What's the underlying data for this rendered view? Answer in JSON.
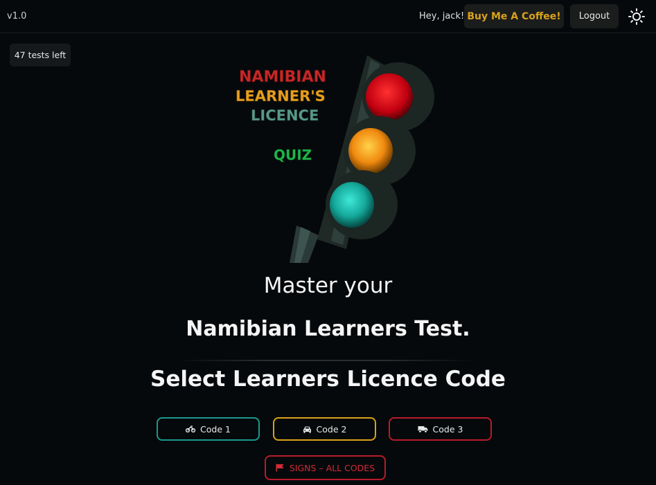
{
  "header": {
    "version": "v1.0",
    "greeting": "Hey, jack!",
    "coffee_label": "Buy Me A Coffee!",
    "logout_label": "Logout",
    "theme_icon": "sun-icon"
  },
  "badge": {
    "tests_left": "47 tests left"
  },
  "logo": {
    "line1": "NAMIBIAN",
    "line2": "LEARNER'S",
    "line3": "LICENCE",
    "line4": "QUIZ"
  },
  "hero": {
    "tagline_1": "Master your",
    "tagline_2": "Namibian Learners Test.",
    "select_title": "Select Learners Licence Code"
  },
  "codes": [
    {
      "label": "Code 1",
      "icon": "motorcycle-icon",
      "color": "#1a9a8c"
    },
    {
      "label": "Code 2",
      "icon": "car-icon",
      "color": "#d9a21b"
    },
    {
      "label": "Code 3",
      "icon": "truck-icon",
      "color": "#b71c2a"
    }
  ],
  "signs": {
    "label": "SIGNS – ALL CODES",
    "icon": "flag-icon",
    "color": "#d42a35"
  },
  "colors": {
    "background": "#06090b",
    "accent_gold": "#d9a21b",
    "accent_teal": "#1a9a8c",
    "accent_red": "#b71c2a"
  }
}
